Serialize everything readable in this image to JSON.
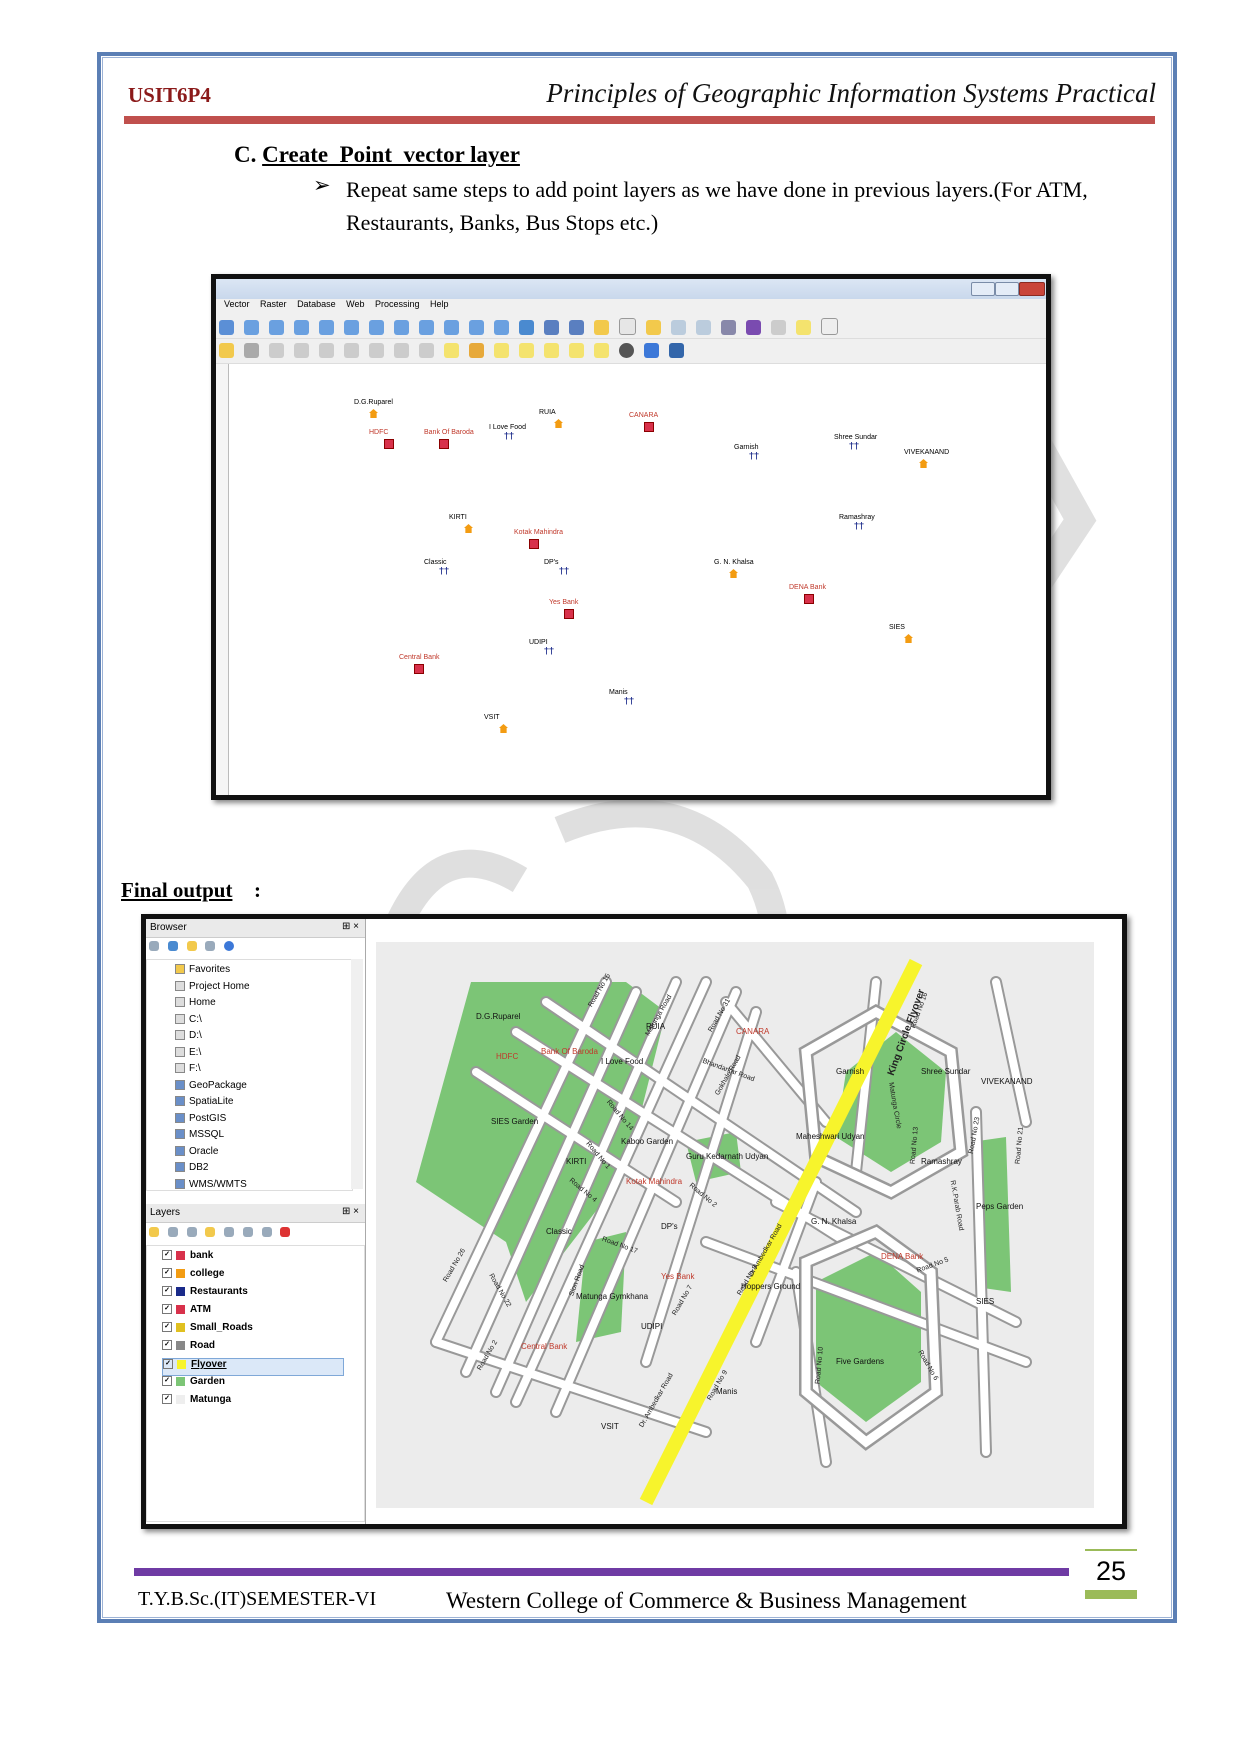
{
  "header": {
    "code": "USIT6P4",
    "title": "Principles of Geographic Information Systems Practical"
  },
  "section": {
    "letter": "C.",
    "title": "Create  Point  vector layer"
  },
  "bullet": {
    "symbol": "➢",
    "text": "Repeat same steps to add point layers as we have done in previous layers.(For ATM, Restaurants, Banks, Bus Stops etc.)"
  },
  "screenshot1": {
    "menu": [
      "Vector",
      "Raster",
      "Database",
      "Web",
      "Processing",
      "Help"
    ],
    "points": [
      {
        "label": "D.G.Ruparel",
        "type": "college"
      },
      {
        "label": "RUIA",
        "type": "college"
      },
      {
        "label": "CANARA",
        "type": "bank"
      },
      {
        "label": "HDFC",
        "type": "bank"
      },
      {
        "label": "Bank Of Baroda",
        "type": "bank"
      },
      {
        "label": "I Love Food",
        "type": "restaurant"
      },
      {
        "label": "Garnish",
        "type": "restaurant"
      },
      {
        "label": "Shree Sundar",
        "type": "restaurant"
      },
      {
        "label": "VIVEKANAND",
        "type": "college"
      },
      {
        "label": "KIRTI",
        "type": "college"
      },
      {
        "label": "Kotak Mahindra",
        "type": "bank"
      },
      {
        "label": "Ramashray",
        "type": "restaurant"
      },
      {
        "label": "Classic",
        "type": "restaurant"
      },
      {
        "label": "DP's",
        "type": "restaurant"
      },
      {
        "label": "G. N. Khalsa",
        "type": "college"
      },
      {
        "label": "DENA Bank",
        "type": "bank"
      },
      {
        "label": "Yes Bank",
        "type": "bank"
      },
      {
        "label": "SIES",
        "type": "college"
      },
      {
        "label": "UDIPI",
        "type": "restaurant"
      },
      {
        "label": "Central Bank",
        "type": "bank"
      },
      {
        "label": "Manis",
        "type": "restaurant"
      },
      {
        "label": "VSIT",
        "type": "college"
      }
    ]
  },
  "final_output": {
    "label": "Final output",
    "colon": ":"
  },
  "screenshot2": {
    "browser": {
      "title": "Browser",
      "items": [
        "Favorites",
        "Project Home",
        "Home",
        "C:\\",
        "D:\\",
        "E:\\",
        "F:\\",
        "GeoPackage",
        "SpatiaLite",
        "PostGIS",
        "MSSQL",
        "Oracle",
        "DB2",
        "WMS/WMTS"
      ]
    },
    "layers": {
      "title": "Layers",
      "items": [
        "bank",
        "college",
        "Restaurants",
        "ATM",
        "Small_Roads",
        "Road",
        "Flyover",
        "Garden",
        "Matunga"
      ],
      "selected": "Flyover"
    },
    "map_labels": {
      "places": [
        "D.G.Ruparel",
        "RUIA",
        "CANARA",
        "HDFC",
        "Bank Of Baroda",
        "I Love Food",
        "Garnish",
        "Shree Sundar",
        "VIVEKANAND",
        "SIES Garden",
        "KIRTI",
        "Kotak Mahindra",
        "Kaboo Garden",
        "Guru Kedarnath Udyan",
        "Maheshwari Udyan",
        "Ramashray",
        "Peps Garden",
        "G. N. Khalsa",
        "Classic",
        "DP's",
        "DENA Bank",
        "Yes Bank",
        "Matunga Gymkhana",
        "Hoppers Ground",
        "Five Gardens",
        "SIES",
        "Central Bank",
        "UDIPI",
        "Manis",
        "VSIT"
      ],
      "roads": [
        "Road No 15",
        "Road No 31",
        "Bhandarkar Road",
        "Road No 14",
        "King Circle Flyover",
        "Matunga Circle",
        "Road No 16",
        "Road No 13",
        "Road No 23",
        "Road No 21",
        "Road No 1",
        "Road No 4",
        "Road No 2",
        "Road No 17",
        "Road No 26",
        "Road No 22",
        "Road No 2",
        "Road No 7",
        "Road No 8",
        "Road No 9",
        "Road No 10",
        "Road No 6",
        "Road No 5",
        "R.K.Parab Road",
        "Dr. Ambedkar Road",
        "Sion Road",
        "Dr Ambedkar Road",
        "Gokhale Road",
        "Matunga Road"
      ]
    }
  },
  "footer": {
    "left": "T.Y.B.Sc.(IT)SEMESTER-VI",
    "middle": "Western College of Commerce & Business Management",
    "page": "25"
  },
  "colors": {
    "border": "#5b7fb5",
    "header_rule": "#c0504d",
    "footer_rule": "#6f3ba4",
    "accent_green": "#9bbb59",
    "garden": "#7cc576",
    "flyover": "#f7f42c"
  }
}
